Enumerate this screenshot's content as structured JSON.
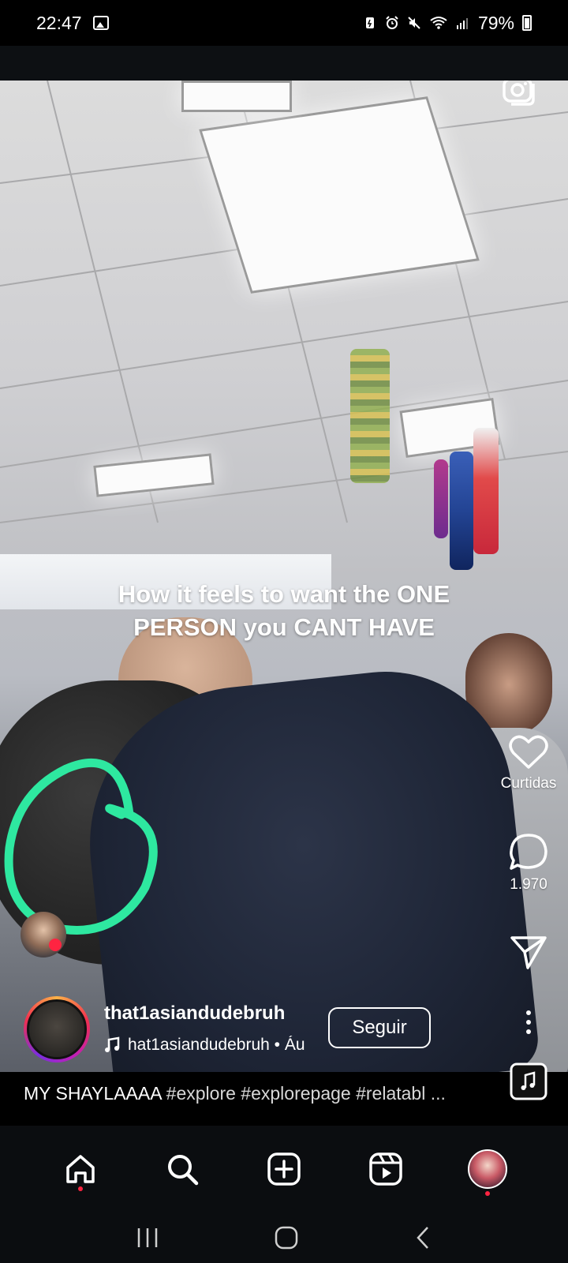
{
  "status_bar": {
    "time": "22:47",
    "battery": "79%",
    "icons": [
      "gallery-icon",
      "battery-saver-icon",
      "alarm-icon",
      "mute-icon",
      "wifi-icon",
      "signal-icon",
      "battery-icon"
    ]
  },
  "reel": {
    "overlay_text_line1": "How it feels to want the ONE",
    "overlay_text_line2": "PERSON you CANT HAVE",
    "username": "that1asiandudebruh",
    "audio_label": "hat1asiandudebruh • Áu",
    "follow_label": "Seguir",
    "caption_lead": "MY SHAYLAAAA",
    "caption_hashtags": " #explore #explorepage #relatabl ...",
    "accent_color": "#2ee8a0"
  },
  "actions": {
    "likes_label": "Curtidas",
    "comments_count": "1.970"
  },
  "bottom_nav": {
    "items": [
      "home",
      "search",
      "create",
      "reels",
      "profile"
    ]
  }
}
